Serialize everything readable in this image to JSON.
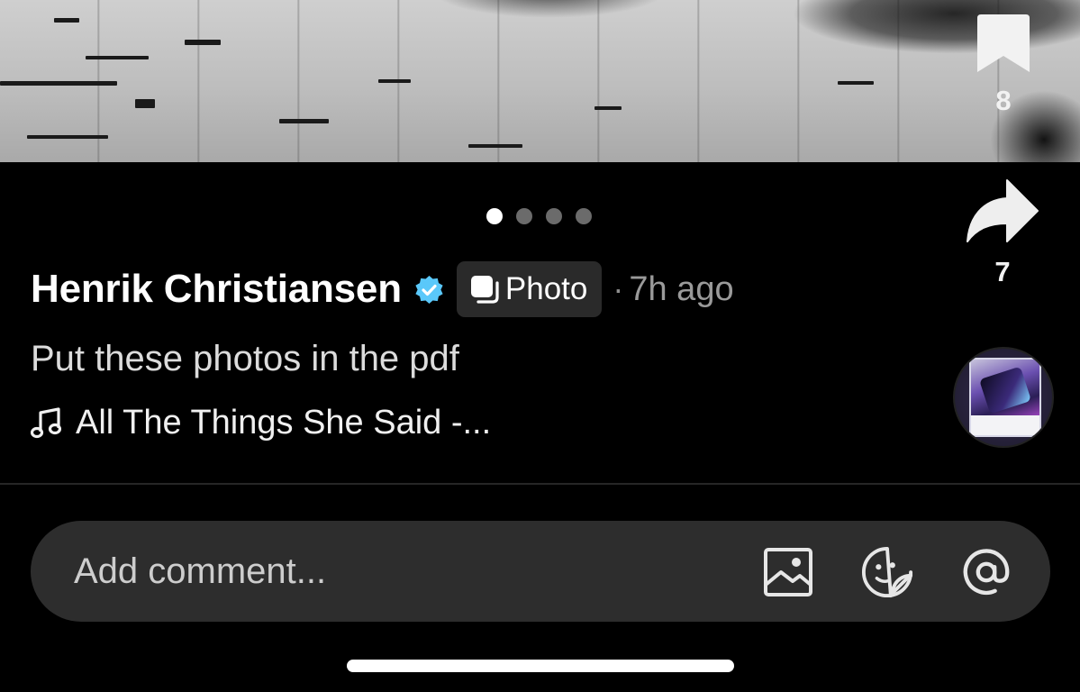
{
  "post": {
    "author_name": "Henrik Christiansen",
    "verified_icon": "verified-badge-icon",
    "type_label": "Photo",
    "time_separator": "·",
    "timestamp": "7h ago",
    "caption": "Put these photos in the pdf",
    "music_title": "All The Things She Said -..."
  },
  "carousel": {
    "total": 4,
    "active_index": 0
  },
  "actions": {
    "bookmark": {
      "icon": "bookmark-icon",
      "count": "8"
    },
    "share": {
      "icon": "share-icon",
      "count": "7"
    }
  },
  "album": {
    "icon": "album-disc"
  },
  "comment": {
    "placeholder": "Add comment...",
    "icons": [
      "image-icon",
      "sticker-icon",
      "mention-icon"
    ]
  },
  "colors": {
    "background": "#000000",
    "verified": "#5ac8fa",
    "badge_bg": "#2a2a2a",
    "comment_bar": "#2d2d2d"
  }
}
